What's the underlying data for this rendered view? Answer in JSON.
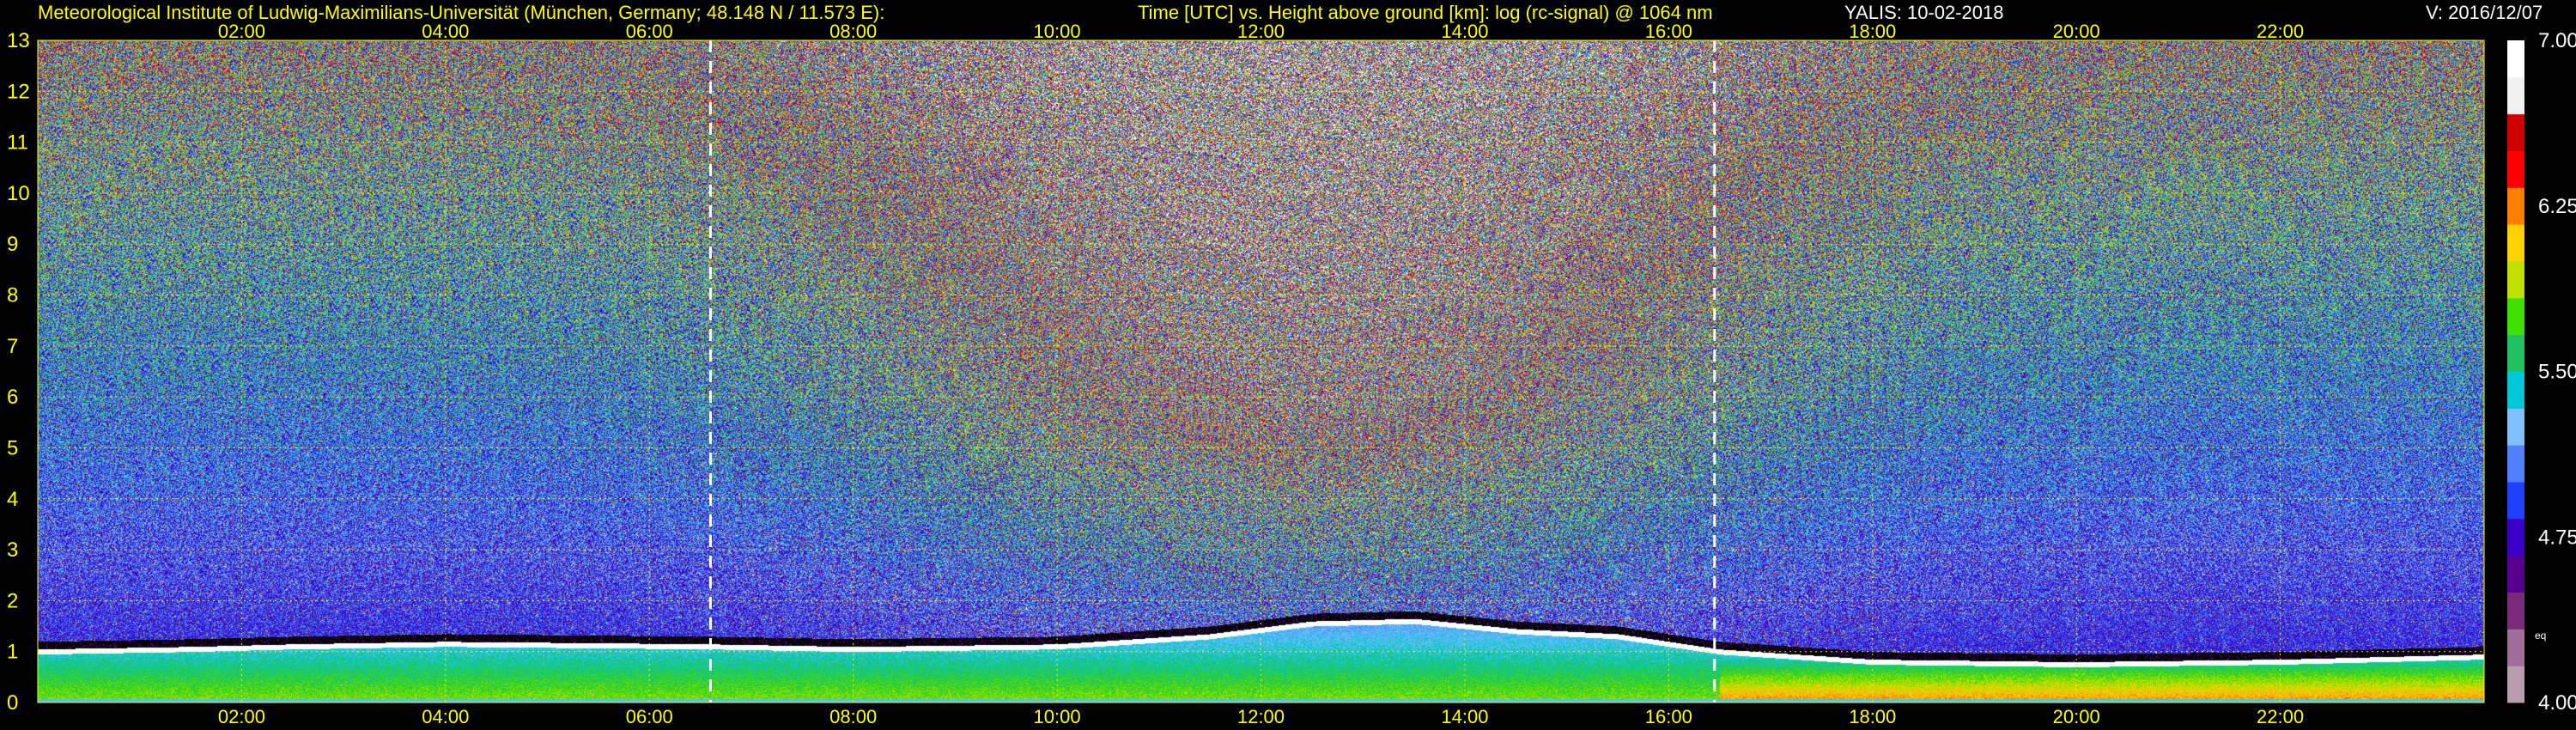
{
  "header": {
    "institute": "Meteorological Institute of Ludwig-Maximilians-Universität (München, Germany; 48.148 N / 11.573 E):",
    "plot_description": "Time [UTC] vs. Height above ground [km]: log (rc-signal) @ 1064 nm",
    "instrument_date": "YALIS: 10-02-2018",
    "version": "V: 2016/12/07"
  },
  "chart_data": {
    "type": "heatmap",
    "xlabel": "Time [UTC]",
    "ylabel": "Height above ground [km]",
    "x_ticks": [
      "02:00",
      "04:00",
      "06:00",
      "08:00",
      "10:00",
      "12:00",
      "14:00",
      "16:00",
      "18:00",
      "20:00",
      "22:00"
    ],
    "x_tick_hours": [
      2,
      4,
      6,
      8,
      10,
      12,
      14,
      16,
      18,
      20,
      22
    ],
    "xlim_hours": [
      0,
      24
    ],
    "y_ticks": [
      0,
      1,
      2,
      3,
      4,
      5,
      6,
      7,
      8,
      9,
      10,
      11,
      12,
      13
    ],
    "ylim_km": [
      0,
      13
    ],
    "grid": true,
    "grid_color": "#ffff00",
    "dashed_markers_hours": [
      6.6,
      16.45
    ],
    "colorbar": {
      "range": [
        4.0,
        7.0
      ],
      "tick_labels": [
        "4.00",
        "4.75",
        "5.50",
        "6.25",
        "7.00"
      ],
      "tick_values": [
        4.0,
        4.75,
        5.5,
        6.25,
        7.0
      ],
      "extra_label": "eq",
      "colors": [
        "#b89cb0",
        "#a06e9a",
        "#7a2a7a",
        "#5a0090",
        "#3a00c8",
        "#2040ff",
        "#5080ff",
        "#80c0ff",
        "#00c8d8",
        "#20c060",
        "#40e000",
        "#c0e000",
        "#ffd000",
        "#ff8000",
        "#ff0000",
        "#d00000",
        "#f0f0f0",
        "#ffffff"
      ]
    },
    "cloud_base_km": [
      {
        "t": 0.0,
        "h": 1.0
      },
      {
        "t": 1.5,
        "h": 1.05
      },
      {
        "t": 2.5,
        "h": 1.1
      },
      {
        "t": 4.0,
        "h": 1.15
      },
      {
        "t": 6.6,
        "h": 1.1
      },
      {
        "t": 8.0,
        "h": 1.05
      },
      {
        "t": 10.0,
        "h": 1.1
      },
      {
        "t": 11.5,
        "h": 1.3
      },
      {
        "t": 12.5,
        "h": 1.55
      },
      {
        "t": 13.5,
        "h": 1.6
      },
      {
        "t": 14.5,
        "h": 1.4
      },
      {
        "t": 15.5,
        "h": 1.3
      },
      {
        "t": 16.5,
        "h": 1.0
      },
      {
        "t": 18.0,
        "h": 0.8
      },
      {
        "t": 20.0,
        "h": 0.75
      },
      {
        "t": 22.0,
        "h": 0.8
      },
      {
        "t": 24.0,
        "h": 0.9
      }
    ]
  }
}
